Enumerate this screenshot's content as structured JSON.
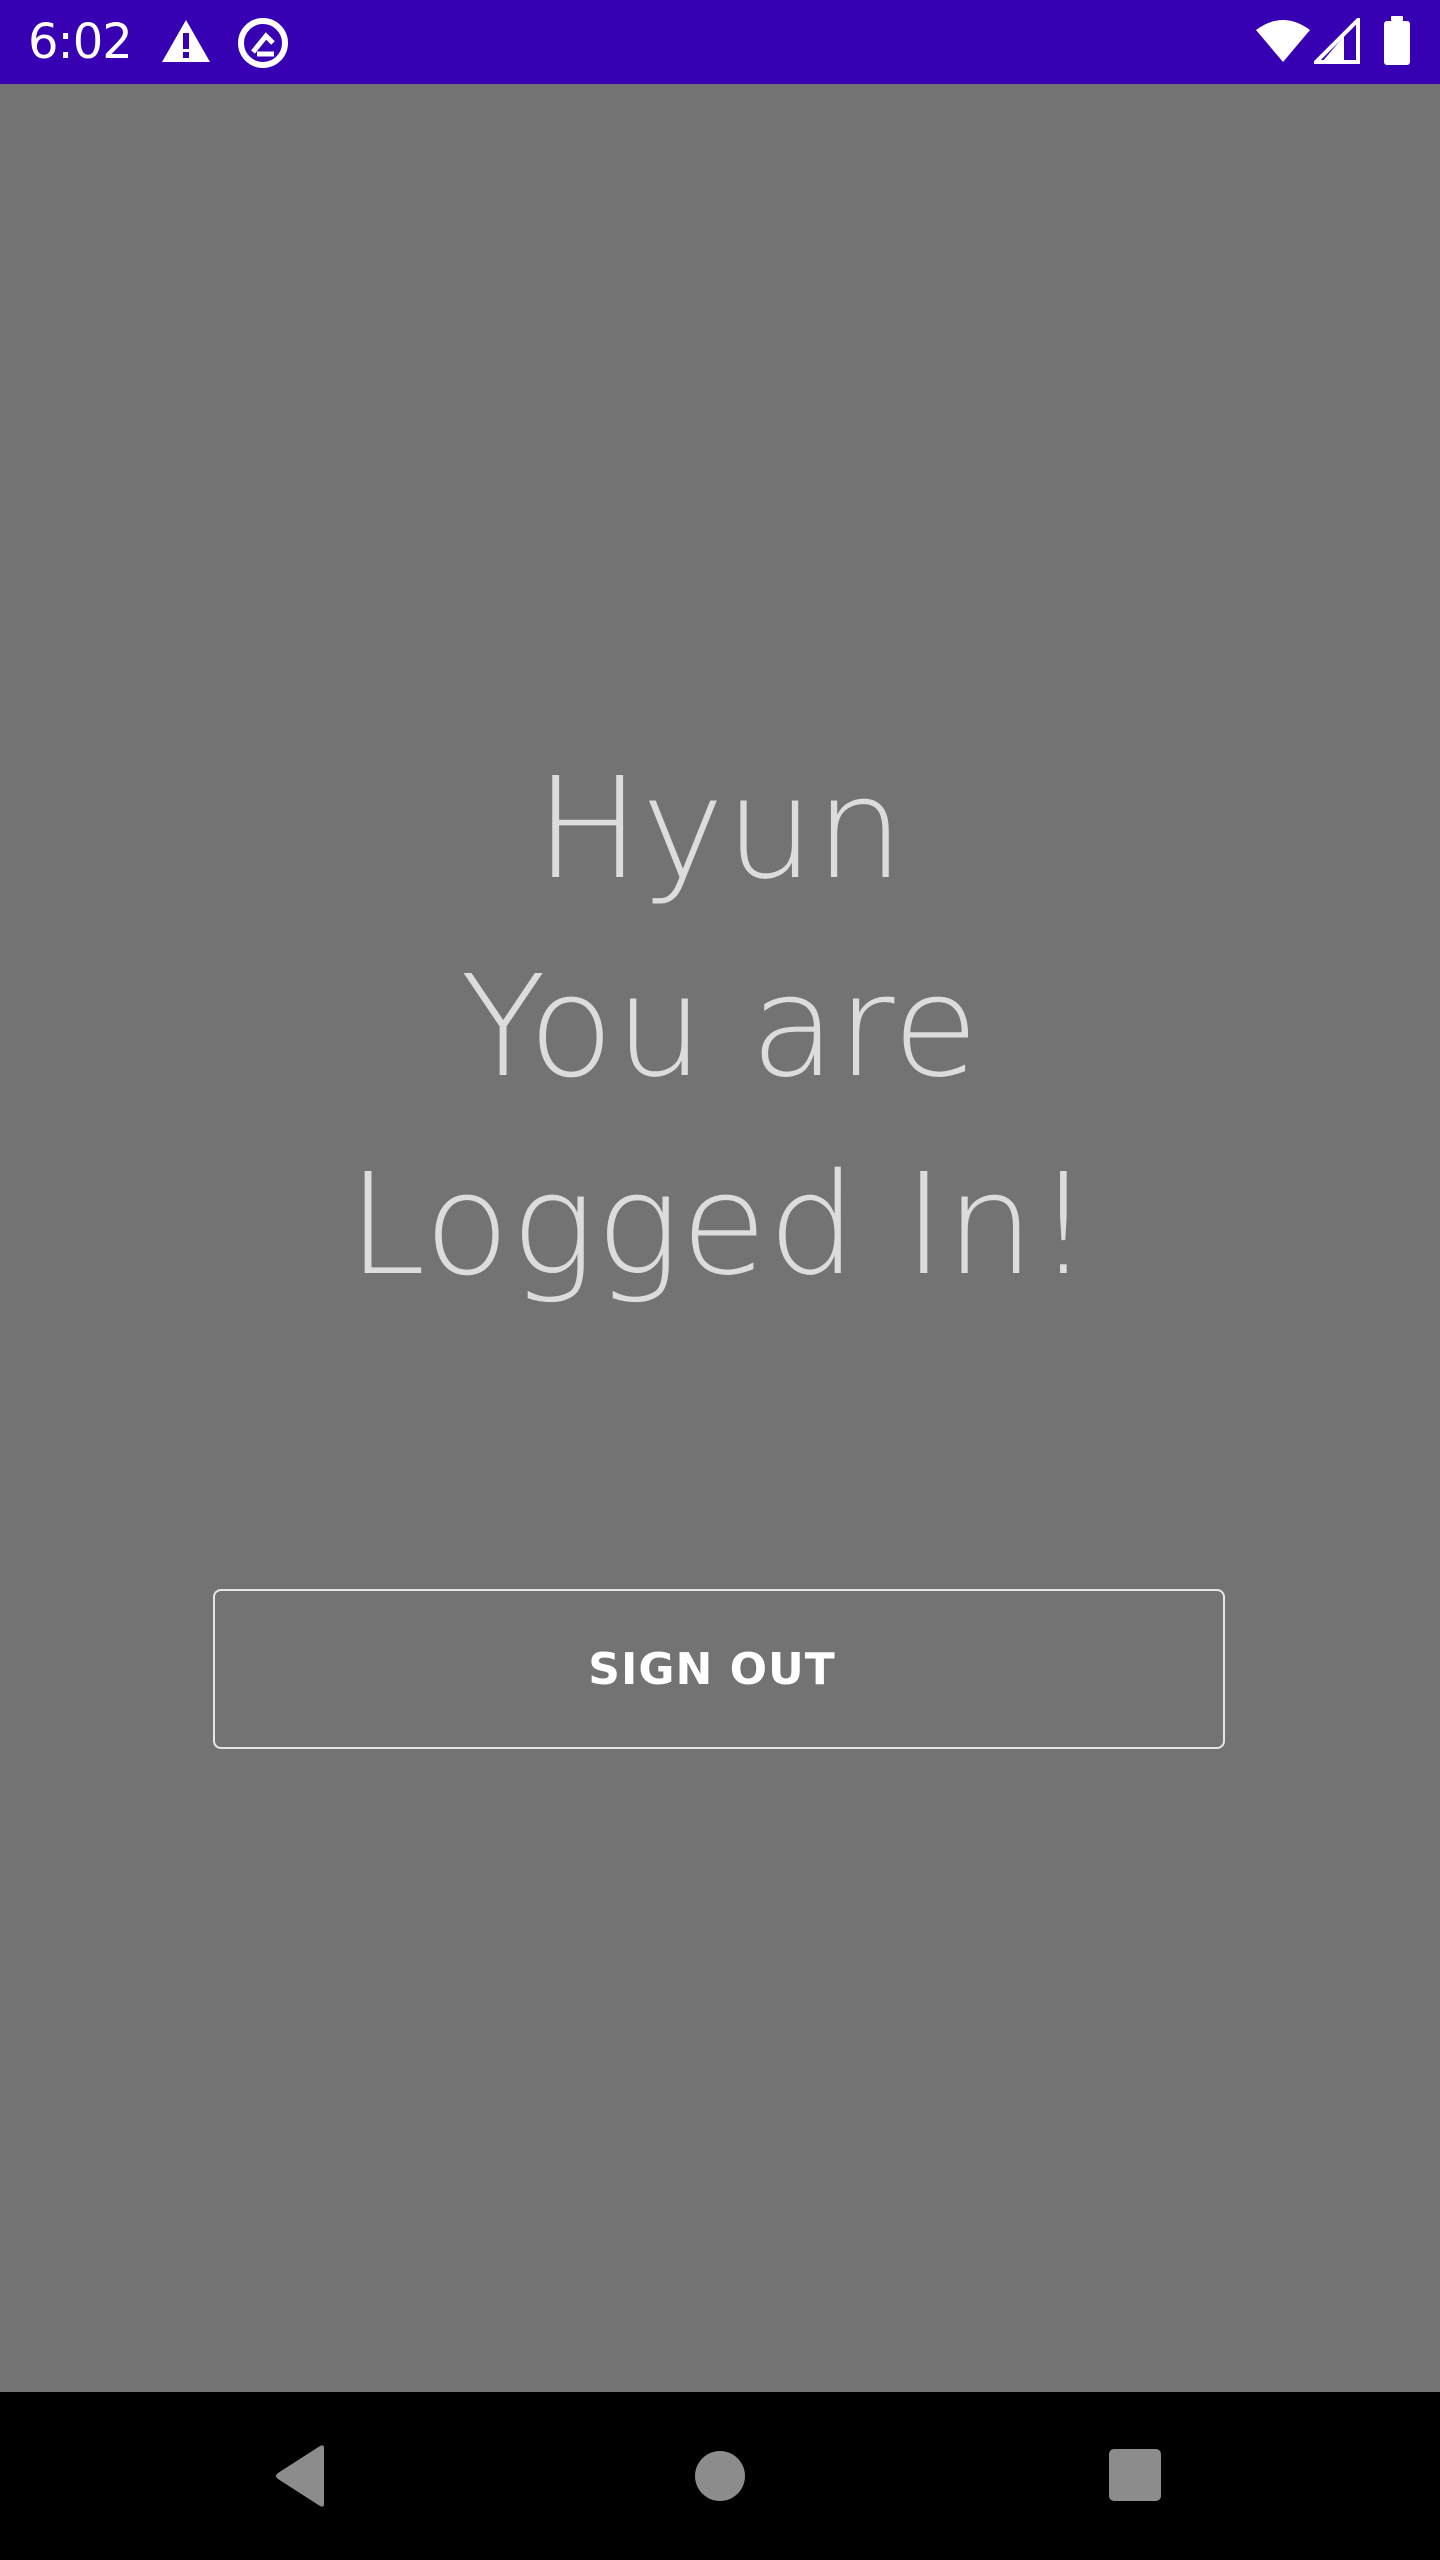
{
  "status_bar": {
    "time": "6:02",
    "background_color": "#3700b3",
    "left_icons": [
      "warning-icon",
      "data-saver-icon"
    ],
    "right_icons": [
      "wifi-icon",
      "cell-signal-icon",
      "battery-icon"
    ]
  },
  "main": {
    "background_color": "#737373",
    "user_name": "Hyun",
    "message_line_1": "You are",
    "message_line_2": "Logged In!",
    "sign_out_label": "SIGN OUT"
  },
  "nav_bar": {
    "buttons": [
      "back-icon",
      "home-icon",
      "recents-icon"
    ]
  }
}
